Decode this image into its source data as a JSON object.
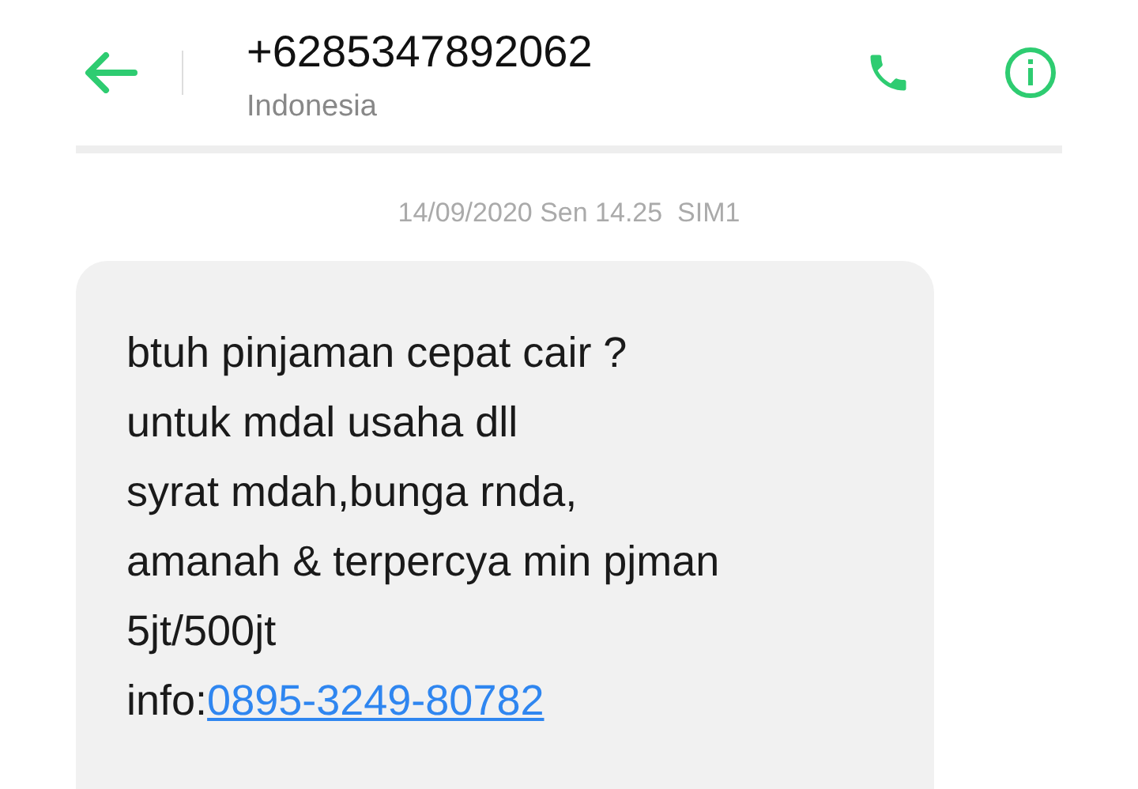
{
  "header": {
    "title": "+6285347892062",
    "subtitle": "Indonesia"
  },
  "timestamp": "14/09/2020 Sen 14.25  SIM1",
  "message": {
    "text": " btuh pinjaman cepat cair ?\nuntuk mdal usaha dll\nsyrat mdah,bunga rnda,\namanah & terpercya min pjman\n5jt/500jt\ninfo:",
    "link": "0895-3249-80782"
  }
}
